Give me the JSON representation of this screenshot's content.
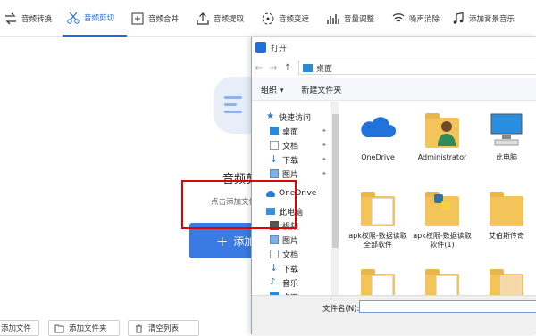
{
  "toolbar": {
    "items": [
      {
        "label": "音频转换",
        "icon": "convert-icon"
      },
      {
        "label": "音频剪切",
        "icon": "scissors-icon",
        "active": true
      },
      {
        "label": "音频合并",
        "icon": "merge-icon"
      },
      {
        "label": "音频提取",
        "icon": "extract-icon"
      },
      {
        "label": "音频变速",
        "icon": "speed-icon"
      },
      {
        "label": "音量调整",
        "icon": "volume-bars-icon"
      },
      {
        "label": "噪声消除",
        "icon": "noise-wave-icon"
      },
      {
        "label": "添加背景音乐",
        "icon": "music-note-icon"
      }
    ],
    "accent_color": "#1f6fd6"
  },
  "main": {
    "title": "音频剪",
    "subtitle": "点击添加文件或拖",
    "add_button": {
      "symbol": "+",
      "label": "添加"
    },
    "bottom_buttons": [
      "添加文件",
      "添加文件夹",
      "清空列表"
    ],
    "highlight_color": "#e00000"
  },
  "dialog": {
    "title": "打开",
    "address": "桌面",
    "nav_back": "←",
    "nav_forward": "→",
    "nav_up": "↑",
    "commands": {
      "organize": "组织 ▾",
      "new_folder": "新建文件夹"
    },
    "nav_items": {
      "quick_access": "快速访问",
      "desktop": "桌面",
      "documents": "文档",
      "downloads": "下载",
      "pictures": "图片",
      "onedrive": "OneDrive",
      "this_pc": "此电脑",
      "videos": "视频",
      "pictures2": "图片",
      "documents2": "文档",
      "downloads2": "下载",
      "music": "音乐",
      "desktop2": "桌面"
    },
    "files": [
      {
        "name": "OneDrive",
        "type": "cloud"
      },
      {
        "name": "Administrator",
        "type": "user"
      },
      {
        "name": "此电脑",
        "type": "computer"
      },
      {
        "name": "apk权限-数据读取全部软件",
        "type": "folder"
      },
      {
        "name": "apk权限-数据读取软件(1)",
        "type": "folder-python"
      },
      {
        "name": "艾伯斯传奇",
        "type": "folder"
      },
      {
        "name": "",
        "type": "folder"
      },
      {
        "name": "",
        "type": "folder"
      },
      {
        "name": "",
        "type": "folder"
      }
    ],
    "filename_label": "文件名(N):",
    "filename_value": ""
  }
}
